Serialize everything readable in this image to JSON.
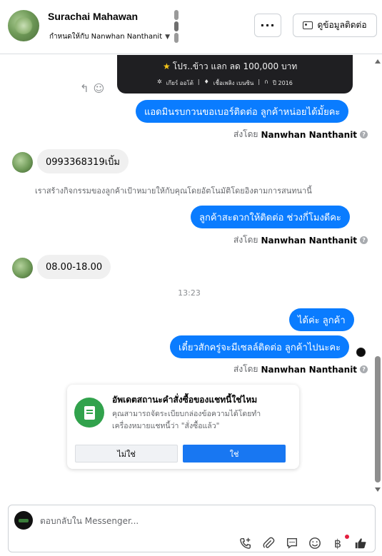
{
  "header": {
    "contact_name": "Surachai Mahawan",
    "assigned_to": "กำหนดให้กับ Nanwhan Nanthanit",
    "more_label": "···",
    "contact_info_label": "ดูข้อมูลติดต่อ"
  },
  "promo": {
    "line1": "โปร..ข้าว แลก ลด 100,000 บาท",
    "tag1": "เกียร์ ออโต้",
    "tag2": "เชื้อเพลิง เบนซิน",
    "tag3": "ปี 2016"
  },
  "messages": {
    "out1": "แอดมินรบกวนขอเบอร์ติดต่อ ลูกค้าหน่อยได้มั้ยคะ",
    "sent_by_prefix": "ส่งโดย",
    "sent_by_name": "Nanwhan Nanthanit",
    "in1": "0993368319เบิ้ม",
    "system_note": "เราสร้างกิจกรรมของลูกค้าเป้าหมายให้กับคุณโดยอัตโนมัติโดยอิงตามการสนทนานี้",
    "out2": "ลูกค้าสะดวกให้ติดต่อ ช่วงกี่โมงดีคะ",
    "in2": "08.00-18.00",
    "time": "13:23",
    "out3": "ได้ค่ะ ลูกค้า",
    "out4": "เดี๋ยวสักครู่จะมีเซลล์ติดต่อ ลูกค้าไปนะคะ"
  },
  "card": {
    "title": "อัพเดตสถานะคำสั่งซื้อของแชทนี้ใช่ไหม",
    "body": "คุณสามารถจัดระเบียบกล่องข้อความได้โดยทำเครื่องหมายแชทนี้ว่า \"สั่งซื้อแล้ว\"",
    "no_label": "ไม่ใช่",
    "yes_label": "ใช่"
  },
  "composer": {
    "placeholder": "ตอบกลับใน Messenger...",
    "currency_symbol": "฿"
  },
  "colors": {
    "outgoing_bubble": "#0a7cff",
    "incoming_bubble": "#f0f0f0",
    "primary_button": "#1877f2",
    "card_icon": "#31a24c",
    "notification_dot": "#e41e3f"
  },
  "icons": [
    "more-icon",
    "contact-card-icon",
    "reply-icon",
    "emoji-react-icon",
    "help-icon",
    "receipt-icon",
    "call-add-icon",
    "attachment-icon",
    "saved-replies-icon",
    "emoji-icon",
    "payment-icon",
    "thumbs-up-icon"
  ]
}
